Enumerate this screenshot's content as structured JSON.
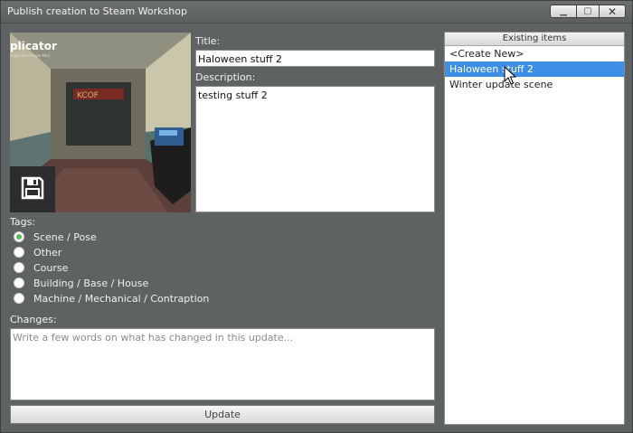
{
  "window": {
    "title": "Publish creation to Steam Workshop",
    "controls": {
      "minimize": "▁",
      "maximize": "▢",
      "close": "✕"
    }
  },
  "thumbnail": {
    "logo_text": "plicator",
    "sub_text": "Duplicator Single Mod",
    "icon": "save-icon"
  },
  "form": {
    "title_label": "Title:",
    "title_value": "Haloween stuff 2",
    "description_label": "Description:",
    "description_value": "testing stuff 2",
    "tags_label": "Tags:",
    "tags": [
      {
        "label": "Scene / Pose",
        "checked": true
      },
      {
        "label": "Other",
        "checked": false
      },
      {
        "label": "Course",
        "checked": false
      },
      {
        "label": "Building / Base / House",
        "checked": false
      },
      {
        "label": "Machine / Mechanical / Contraption",
        "checked": false
      }
    ],
    "changes_label": "Changes:",
    "changes_placeholder": "Write a few words on what has changed in this update...",
    "update_label": "Update"
  },
  "existing": {
    "header": "Existing items",
    "items": [
      {
        "label": "<Create New>",
        "selected": false
      },
      {
        "label": "Haloween stuff 2",
        "selected": true
      },
      {
        "label": "Winter update scene",
        "selected": false
      }
    ]
  },
  "colors": {
    "background": "#5f6263",
    "selection": "#3d8ee6",
    "radio_checked": "#56b95a"
  }
}
